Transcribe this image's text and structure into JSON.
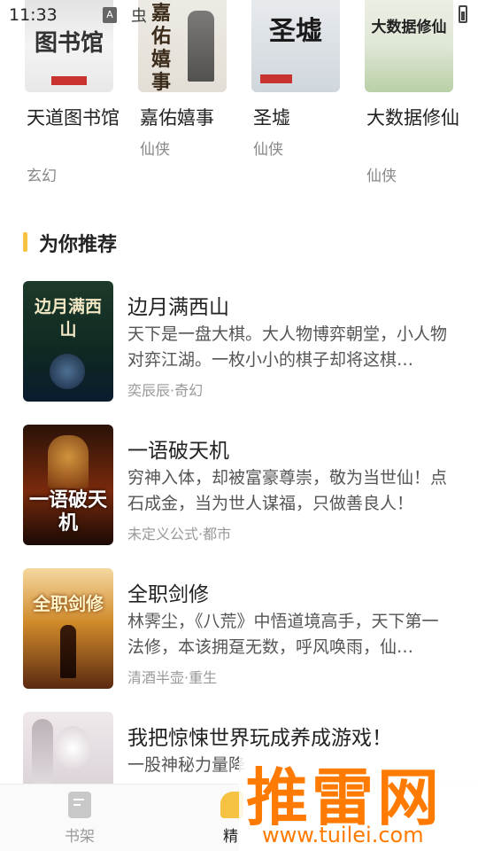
{
  "status_bar": {
    "time": "11:33",
    "icon_a": "A",
    "icon_bug": "虫"
  },
  "top_books": [
    {
      "title": "天道图书馆",
      "genre": "玄幻",
      "cover_text": "图书馆"
    },
    {
      "title": "嘉佑嬉事",
      "genre": "仙侠",
      "cover_text": "嘉佑嬉事"
    },
    {
      "title": "圣墟",
      "genre": "仙侠",
      "cover_text": "圣墟"
    },
    {
      "title": "大数据修仙",
      "genre": "仙侠",
      "cover_text": "大数据修仙"
    }
  ],
  "section": {
    "title": "为你推荐"
  },
  "recommendations": [
    {
      "title": "边月满西山",
      "desc": "天下是一盘大棋。大人物博弈朝堂，小人物对弈江湖。一枚小小的棋子却将这棋…",
      "meta": "奕辰辰·奇幻",
      "cover_text": "边月满西山"
    },
    {
      "title": "一语破天机",
      "desc": "穷神入体，却被富豪尊崇，敬为当世仙！点石成金，当为世人谋福，只做善良人！",
      "meta": "未定义公式·都市",
      "cover_text": "一语破天机"
    },
    {
      "title": "全职剑修",
      "desc": "林霁尘，《八荒》中悟道境高手，天下第一法修，本该拥趸无数，呼风唤雨，仙…",
      "meta": "清酒半壶·重生",
      "cover_text": "全职剑修"
    },
    {
      "title": "我把惊悚世界玩成养成游戏！",
      "desc": "一股神秘力量降",
      "meta": "",
      "cover_text": ""
    }
  ],
  "bottom_nav": [
    {
      "label": "书架"
    },
    {
      "label": "精"
    }
  ],
  "watermark": {
    "big": "推雷网",
    "url": "www.tuilei.com"
  }
}
